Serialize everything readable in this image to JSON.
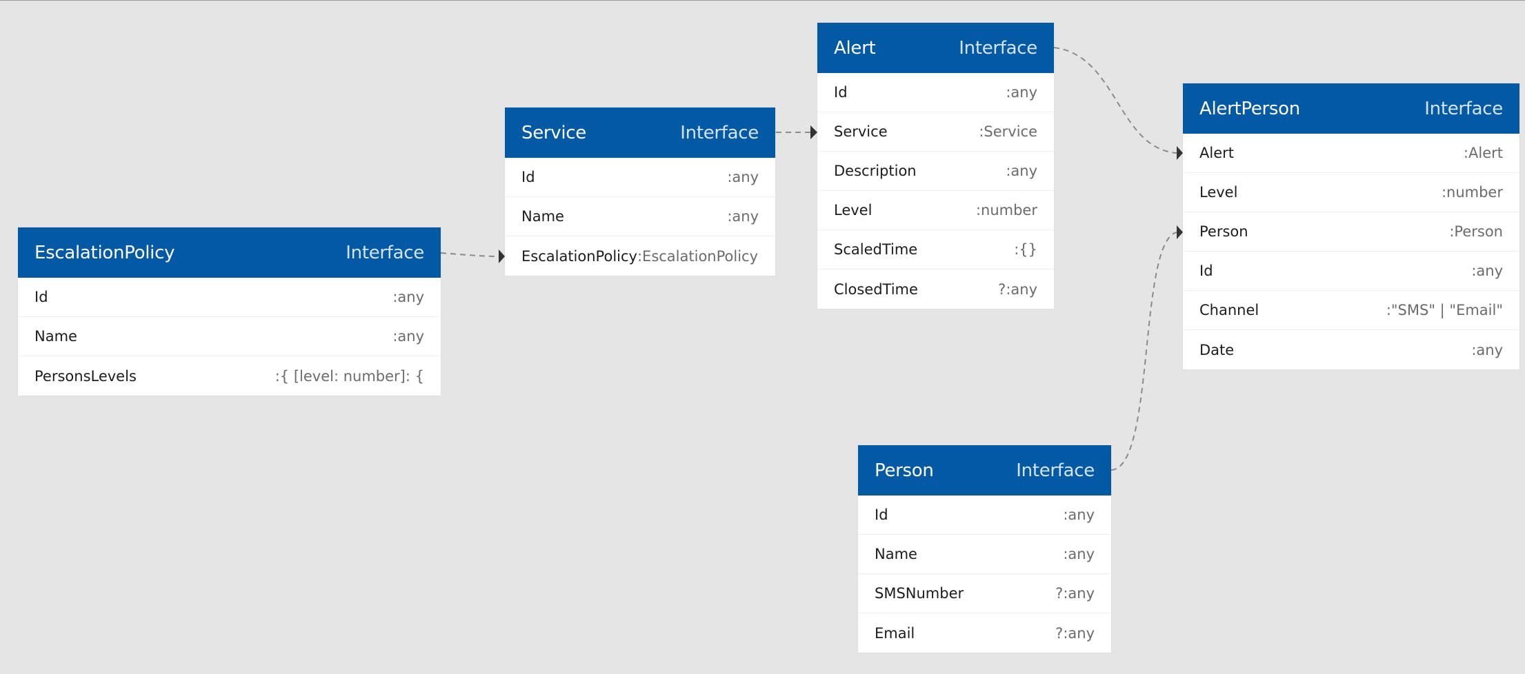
{
  "colors": {
    "canvas": "#e5e5e5",
    "header": "#0459a5",
    "kind_text": "#d4e4f5",
    "connector": "#8a8a8a",
    "arrow": "#333333"
  },
  "entities": {
    "escalationPolicy": {
      "title": "EscalationPolicy",
      "kind": "Interface",
      "fields": [
        {
          "name": "Id",
          "type": ":any"
        },
        {
          "name": "Name",
          "type": ":any"
        },
        {
          "name": "PersonsLevels",
          "type": ":{ [level: number]: {"
        }
      ]
    },
    "service": {
      "title": "Service",
      "kind": "Interface",
      "fields": [
        {
          "name": "Id",
          "type": ":any"
        },
        {
          "name": "Name",
          "type": ":any"
        },
        {
          "name": "EscalationPolicy",
          "type": ":EscalationPolicy"
        }
      ]
    },
    "alert": {
      "title": "Alert",
      "kind": "Interface",
      "fields": [
        {
          "name": "Id",
          "type": ":any"
        },
        {
          "name": "Service",
          "type": ":Service"
        },
        {
          "name": "Description",
          "type": ":any"
        },
        {
          "name": "Level",
          "type": ":number"
        },
        {
          "name": "ScaledTime",
          "type": ":{}"
        },
        {
          "name": "ClosedTime",
          "type": "?:any"
        }
      ]
    },
    "alertPerson": {
      "title": "AlertPerson",
      "kind": "Interface",
      "fields": [
        {
          "name": "Alert",
          "type": ":Alert"
        },
        {
          "name": "Level",
          "type": ":number"
        },
        {
          "name": "Person",
          "type": ":Person"
        },
        {
          "name": "Id",
          "type": ":any"
        },
        {
          "name": "Channel",
          "type": ":\"SMS\" | \"Email\""
        },
        {
          "name": "Date",
          "type": ":any"
        }
      ]
    },
    "person": {
      "title": "Person",
      "kind": "Interface",
      "fields": [
        {
          "name": "Id",
          "type": ":any"
        },
        {
          "name": "Name",
          "type": ":any"
        },
        {
          "name": "SMSNumber",
          "type": "?:any"
        },
        {
          "name": "Email",
          "type": "?:any"
        }
      ]
    }
  }
}
